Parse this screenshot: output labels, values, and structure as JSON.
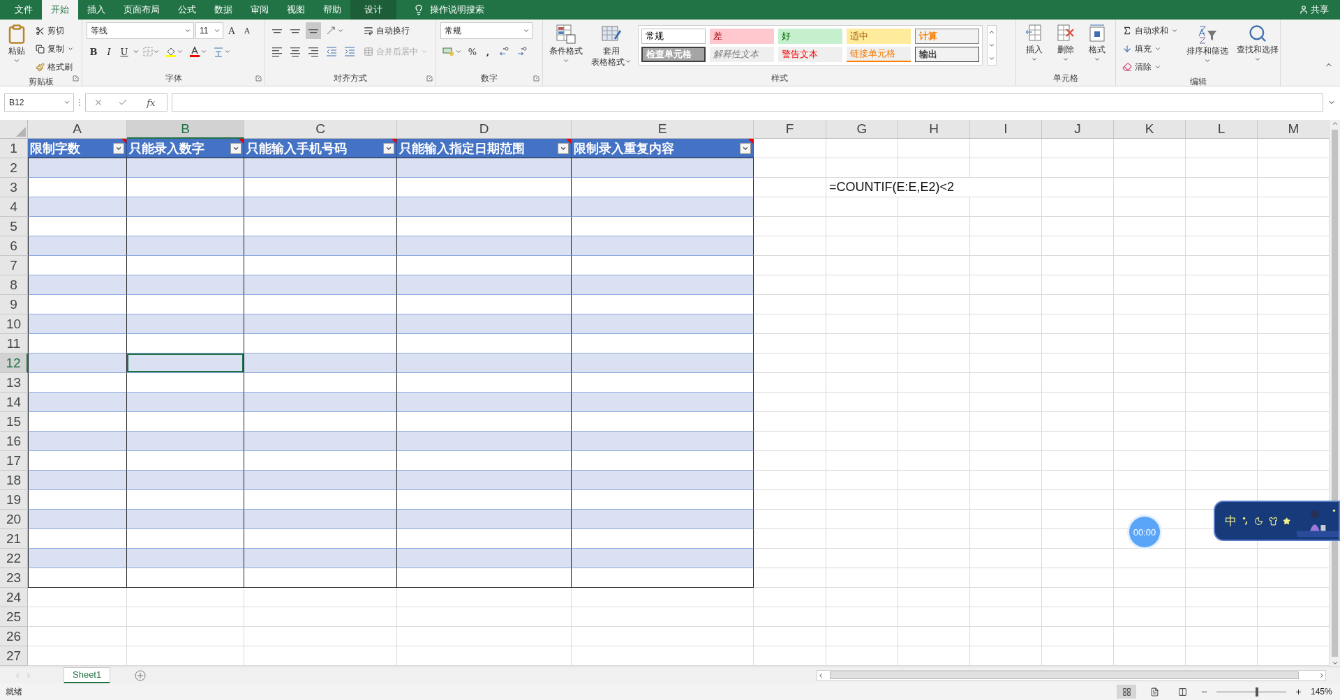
{
  "menu_tabs": [
    {
      "label": "文件",
      "selected": false,
      "kind": "normal"
    },
    {
      "label": "开始",
      "selected": true,
      "kind": "normal"
    },
    {
      "label": "插入",
      "selected": false,
      "kind": "normal"
    },
    {
      "label": "页面布局",
      "selected": false,
      "kind": "normal"
    },
    {
      "label": "公式",
      "selected": false,
      "kind": "normal"
    },
    {
      "label": "数据",
      "selected": false,
      "kind": "normal"
    },
    {
      "label": "审阅",
      "selected": false,
      "kind": "normal"
    },
    {
      "label": "视图",
      "selected": false,
      "kind": "normal"
    },
    {
      "label": "帮助",
      "selected": false,
      "kind": "normal"
    },
    {
      "label": "设计",
      "selected": false,
      "kind": "contextual"
    }
  ],
  "tell_me": "操作说明搜索",
  "share": "共享",
  "clipboard": {
    "paste": "粘贴",
    "cut": "剪切",
    "copy": "复制",
    "format_painter": "格式刷",
    "label": "剪贴板"
  },
  "font": {
    "name": "等线",
    "size": "11",
    "grow": "A",
    "shrink": "A",
    "bold": "B",
    "italic": "I",
    "underline": "U",
    "label": "字体"
  },
  "alignment": {
    "wrap": "自动换行",
    "merge": {
      "label": "合并后居中",
      "disabled": true
    },
    "label": "对齐方式"
  },
  "number": {
    "format": "常规",
    "percent": "%",
    "comma": ",",
    "label": "数字"
  },
  "styles": {
    "conditional": "条件格式",
    "table_format": [
      "套用",
      "表格格式"
    ],
    "label": "样式",
    "gallery": [
      {
        "label": "常规",
        "kind": "normal"
      },
      {
        "label": "差",
        "kind": "bad"
      },
      {
        "label": "好",
        "kind": "good"
      },
      {
        "label": "适中",
        "kind": "neutral"
      },
      {
        "label": "计算",
        "kind": "calculation"
      },
      {
        "label": "检查单元格",
        "kind": "check"
      },
      {
        "label": "解释性文本",
        "kind": "explanatory"
      },
      {
        "label": "警告文本",
        "kind": "warning"
      },
      {
        "label": "链接单元格",
        "kind": "linked"
      },
      {
        "label": "输出",
        "kind": "output"
      }
    ]
  },
  "cells": {
    "insert": "插入",
    "delete": "删除",
    "format": "格式",
    "label": "单元格"
  },
  "editing": {
    "autosum": "自动求和",
    "fill": "填充",
    "clear": "清除",
    "sort": "排序和筛选",
    "find": "查找和选择",
    "label": "编辑"
  },
  "name_box": "B12",
  "function_button": "fx",
  "columns": [
    {
      "label": "A",
      "selected": false
    },
    {
      "label": "B",
      "selected": true
    },
    {
      "label": "C",
      "selected": false
    },
    {
      "label": "D",
      "selected": false
    },
    {
      "label": "E",
      "selected": false
    },
    {
      "label": "F",
      "selected": false
    },
    {
      "label": "G",
      "selected": false
    },
    {
      "label": "H",
      "selected": false
    },
    {
      "label": "I",
      "selected": false
    },
    {
      "label": "J",
      "selected": false
    },
    {
      "label": "K",
      "selected": false
    },
    {
      "label": "L",
      "selected": false
    },
    {
      "label": "M",
      "selected": false
    }
  ],
  "table_headers": [
    {
      "label": "限制字数",
      "comment": true
    },
    {
      "label": "只能录入数字",
      "comment": true
    },
    {
      "label": "只能输入手机号码",
      "comment": true
    },
    {
      "label": "只能输入指定日期范围",
      "comment": true
    },
    {
      "label": "限制录入重复内容",
      "comment": true
    }
  ],
  "rows": [
    {
      "label": "1",
      "kind": "header",
      "selected": false
    },
    {
      "label": "2",
      "kind": "band",
      "selected": false
    },
    {
      "label": "3",
      "kind": "plain",
      "selected": false,
      "note": "=COUNTIF(E:E,E2)<2"
    },
    {
      "label": "4",
      "kind": "band",
      "selected": false
    },
    {
      "label": "5",
      "kind": "plain",
      "selected": false
    },
    {
      "label": "6",
      "kind": "band",
      "selected": false
    },
    {
      "label": "7",
      "kind": "plain",
      "selected": false
    },
    {
      "label": "8",
      "kind": "band",
      "selected": false
    },
    {
      "label": "9",
      "kind": "plain",
      "selected": false
    },
    {
      "label": "10",
      "kind": "band",
      "selected": false
    },
    {
      "label": "11",
      "kind": "plain",
      "selected": false
    },
    {
      "label": "12",
      "kind": "band",
      "selected": true
    },
    {
      "label": "13",
      "kind": "plain",
      "selected": false
    },
    {
      "label": "14",
      "kind": "band",
      "selected": false
    },
    {
      "label": "15",
      "kind": "plain",
      "selected": false
    },
    {
      "label": "16",
      "kind": "band",
      "selected": false
    },
    {
      "label": "17",
      "kind": "plain",
      "selected": false
    },
    {
      "label": "18",
      "kind": "band",
      "selected": false
    },
    {
      "label": "19",
      "kind": "plain",
      "selected": false
    },
    {
      "label": "20",
      "kind": "band",
      "selected": false
    },
    {
      "label": "21",
      "kind": "plain",
      "selected": false
    },
    {
      "label": "22",
      "kind": "band",
      "selected": false
    },
    {
      "label": "23",
      "kind": "plain",
      "selected": false
    },
    {
      "label": "24",
      "kind": "empty",
      "selected": false
    },
    {
      "label": "25",
      "kind": "empty",
      "selected": false
    },
    {
      "label": "26",
      "kind": "empty",
      "selected": false
    },
    {
      "label": "27",
      "kind": "empty",
      "selected": false
    }
  ],
  "sheets": [
    {
      "label": "Sheet1",
      "selected": true
    }
  ],
  "status": "就绪",
  "views": [
    {
      "selected": true
    },
    {
      "selected": false
    },
    {
      "selected": false
    }
  ],
  "zoom": {
    "label": "145%",
    "level": 0.58
  },
  "timer": "00:00",
  "ime": "中"
}
